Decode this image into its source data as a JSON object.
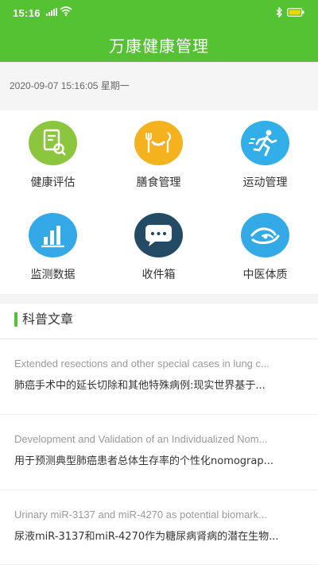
{
  "status_bar": {
    "time": "15:16",
    "icons": [
      "signal-icon",
      "wifi-icon",
      "bluetooth-icon",
      "battery-icon"
    ]
  },
  "header": {
    "title": "万康健康管理",
    "background": "#55c234"
  },
  "datetime": "2020-09-07 15:16:05 星期一",
  "menu": {
    "items": [
      {
        "label": "健康评估",
        "icon": "health-assessment-icon",
        "color": "#8cc63f"
      },
      {
        "label": "膳食管理",
        "icon": "diet-management-icon",
        "color": "#f5b21f"
      },
      {
        "label": "运动管理",
        "icon": "exercise-management-icon",
        "color": "#32aee9"
      },
      {
        "label": "监测数据",
        "icon": "monitoring-data-icon",
        "color": "#35a9e8"
      },
      {
        "label": "收件箱",
        "icon": "inbox-icon",
        "color": "#244b66"
      },
      {
        "label": "中医体质",
        "icon": "tcm-constitution-icon",
        "color": "#33a9e5"
      }
    ]
  },
  "articles_section": {
    "title": "科普文章",
    "items": [
      {
        "en": "Extended resections and other special cases in lung c...",
        "zh": "肺癌手术中的延长切除和其他特殊病例:现实世界基于..."
      },
      {
        "en": "Development and Validation of an Individualized Nom...",
        "zh": "用于预测典型肺癌患者总体生存率的个性化nomograp..."
      },
      {
        "en": "Urinary miR-3137 and miR-4270 as potential biomark...",
        "zh": "尿液miR-3137和miR-4270作为糖尿病肾病的潜在生物..."
      }
    ]
  }
}
